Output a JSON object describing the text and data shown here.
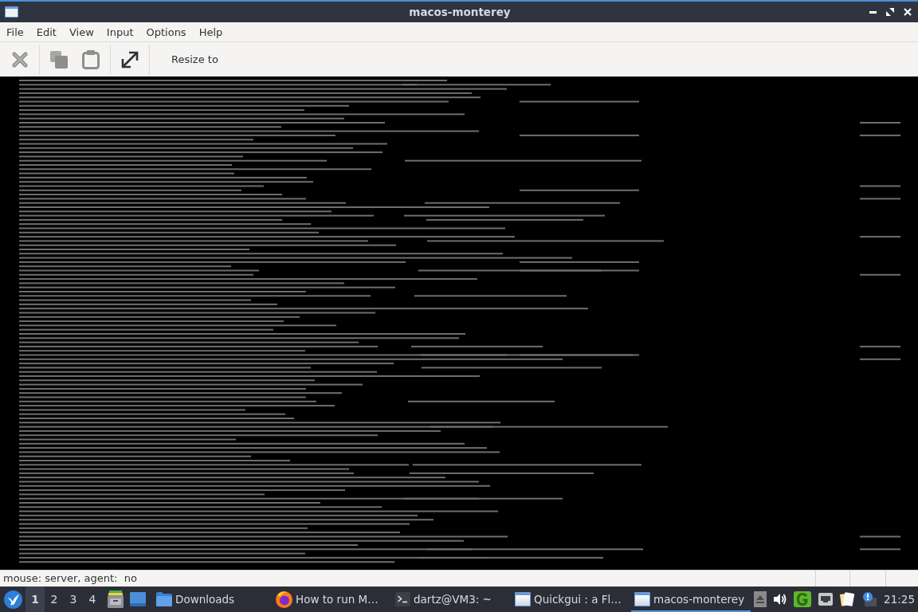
{
  "window": {
    "title": "macos-monterey"
  },
  "menu": [
    "File",
    "Edit",
    "View",
    "Input",
    "Options",
    "Help"
  ],
  "toolbar": {
    "buttons": [
      {
        "kind": "disconnect",
        "disabled": true
      },
      {
        "kind": "copy",
        "disabled": true
      },
      {
        "kind": "paste",
        "disabled": true
      },
      {
        "kind": "fullscreen",
        "disabled": false
      }
    ],
    "resize_label": "Resize to"
  },
  "status_bar": {
    "text": "mouse: server, agent:  no"
  },
  "taskbar": {
    "workspaces": [
      {
        "label": "1",
        "selected": true
      },
      {
        "label": "2",
        "selected": false
      },
      {
        "label": "3",
        "selected": false
      },
      {
        "label": "4",
        "selected": false
      }
    ],
    "tasks": [
      {
        "kind": "folder",
        "label": "Downloads",
        "selected": false
      },
      {
        "kind": "browser",
        "label": "How to run M…",
        "selected": false
      },
      {
        "kind": "terminal",
        "label": "dartz@VM3: ~",
        "selected": false
      },
      {
        "kind": "window",
        "label": "Quickgui : a Fl…",
        "selected": false
      },
      {
        "kind": "window",
        "label": "macos-monterey",
        "selected": true
      }
    ],
    "clock": "21:25"
  }
}
